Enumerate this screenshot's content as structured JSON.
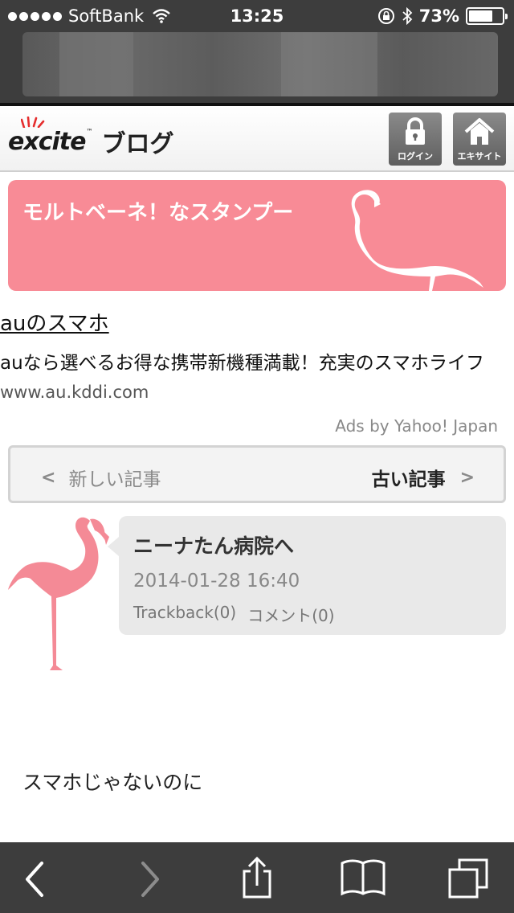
{
  "status_bar": {
    "carrier": "SoftBank",
    "time": "13:25",
    "battery_percent": "73%",
    "battery_level": 0.73
  },
  "header": {
    "logo_text": "excite",
    "logo_tm": "™",
    "blog_label": "ブログ",
    "login_label": "ログイン",
    "home_label": "エキサイト"
  },
  "banner": {
    "text": "モルトベーネ！なスタンプー",
    "color": "#f88b96"
  },
  "ad": {
    "title": "auのスマホ",
    "description": "auなら選べるお得な携帯新機種満載！充実のスマホライフ",
    "url": "www.au.kddi.com",
    "credit": "Ads by Yahoo! Japan"
  },
  "pager": {
    "newer_label": "新しい記事",
    "older_label": "古い記事"
  },
  "post": {
    "title": "ニーナたん病院へ",
    "date": "2014-01-28 16:40",
    "trackback": "Trackback(0)",
    "comment": "コメント(0)",
    "body": "スマホじゃないのに"
  },
  "icons": {
    "back": "chevron-left-icon",
    "forward": "chevron-right-icon",
    "share": "share-icon",
    "bookmarks": "book-icon",
    "tabs": "tabs-icon"
  }
}
